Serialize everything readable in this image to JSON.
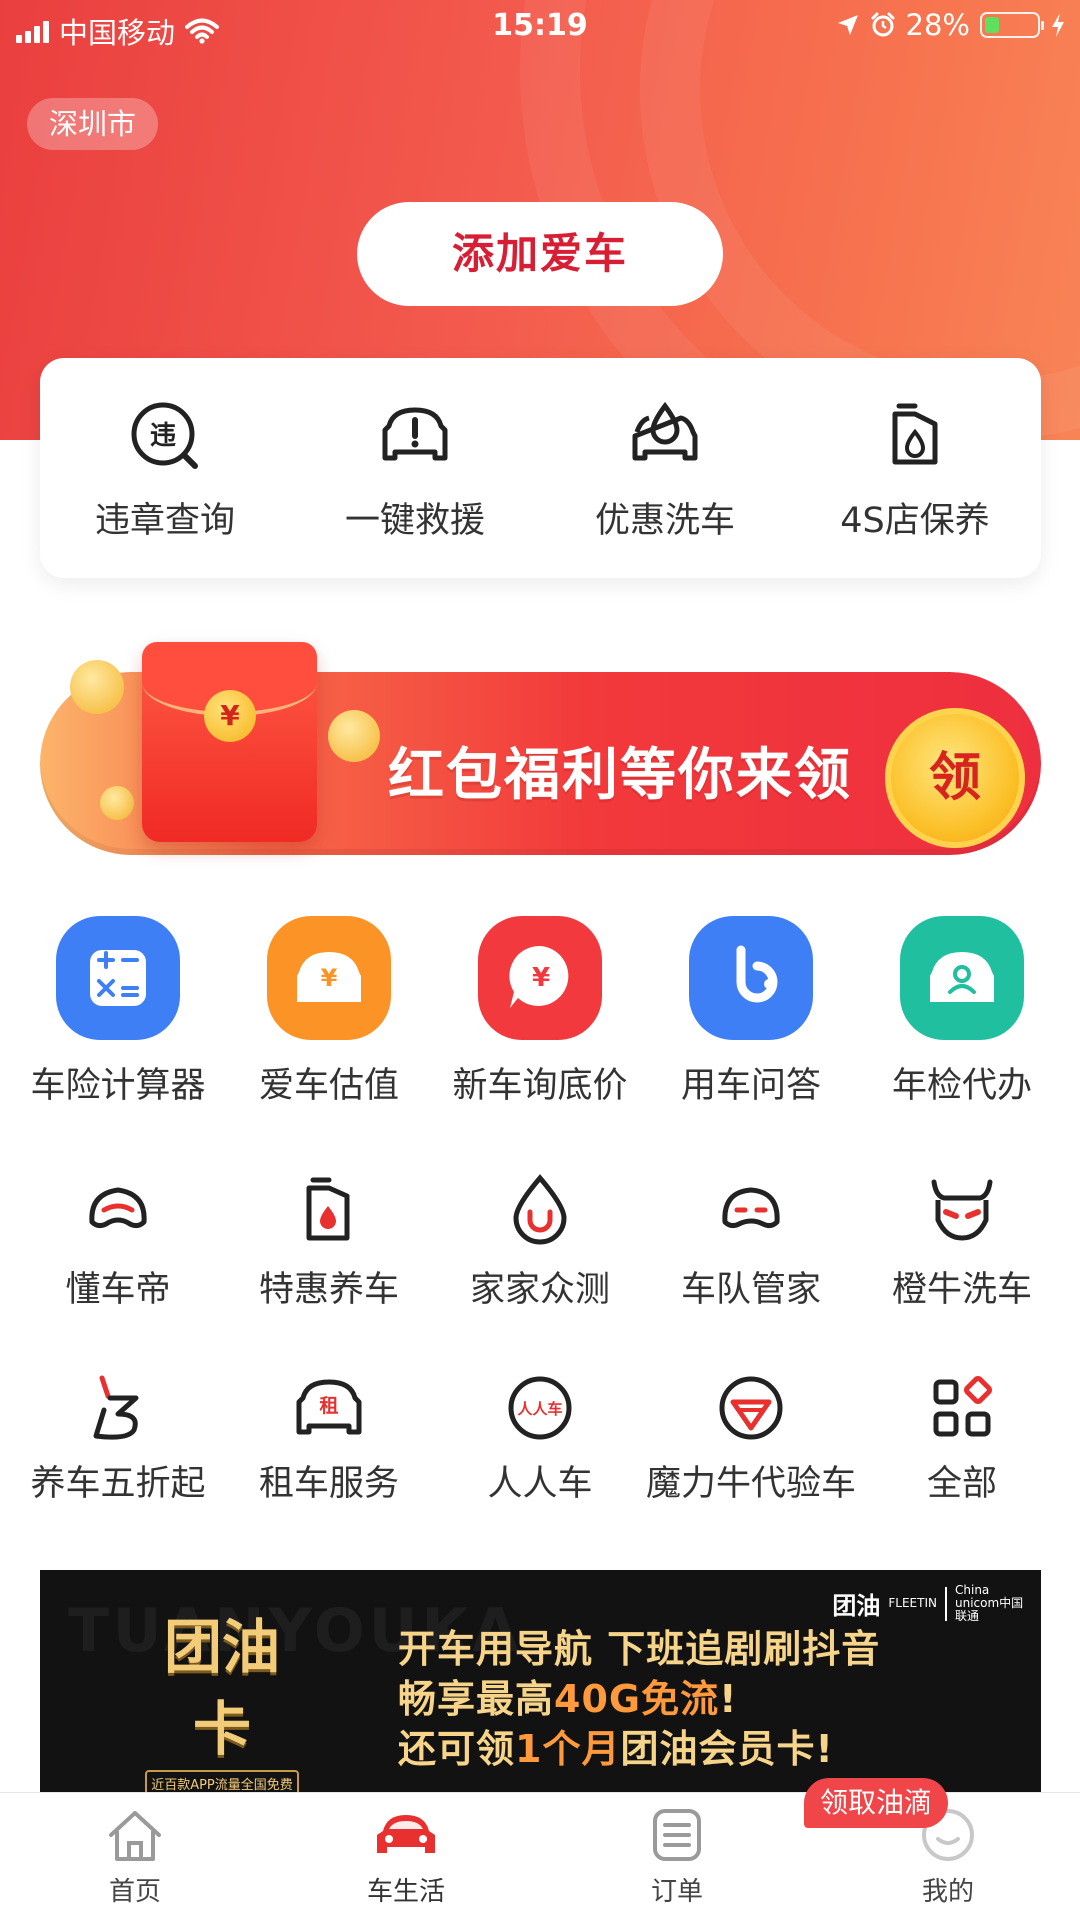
{
  "status_bar": {
    "carrier": "中国移动",
    "time": "15:19",
    "battery": "28%",
    "battery_level": 0.28
  },
  "header": {
    "city": "深圳市",
    "add_car_label": "添加爱车"
  },
  "quick_services": [
    {
      "label": "违章查询",
      "icon": "violation-search-icon",
      "glyph": "违"
    },
    {
      "label": "一键救援",
      "icon": "car-rescue-icon"
    },
    {
      "label": "优惠洗车",
      "icon": "car-wash-icon"
    },
    {
      "label": "4S店保养",
      "icon": "oil-can-icon"
    }
  ],
  "promo_banner": {
    "text": "红包福利等你来领",
    "claim_label": "领",
    "envelope_symbol": "¥"
  },
  "services_row1": [
    {
      "label": "车险计算器",
      "icon": "calculator-icon",
      "color": "#3f7ff5"
    },
    {
      "label": "爱车估值",
      "icon": "car-valuation-icon",
      "color": "#fb9326"
    },
    {
      "label": "新车询底价",
      "icon": "price-inquiry-icon",
      "color": "#f2393e"
    },
    {
      "label": "用车问答",
      "icon": "qa-icon",
      "color": "#3f7ff5"
    },
    {
      "label": "年检代办",
      "icon": "annual-inspection-icon",
      "color": "#1fbf9f"
    }
  ],
  "services_row2": [
    {
      "label": "懂车帝",
      "icon": "dongchedi-icon"
    },
    {
      "label": "特惠养车",
      "icon": "oil-drop-can-icon"
    },
    {
      "label": "家家众测",
      "icon": "magnet-drop-icon"
    },
    {
      "label": "车队管家",
      "icon": "fleet-face-icon"
    },
    {
      "label": "橙牛洗车",
      "icon": "bull-icon"
    }
  ],
  "services_row3": [
    {
      "label": "养车五折起",
      "icon": "discount-logo-icon"
    },
    {
      "label": "租车服务",
      "icon": "rental-car-icon",
      "glyph": "租"
    },
    {
      "label": "人人车",
      "icon": "renrenche-icon",
      "glyph": "人人车"
    },
    {
      "label": "魔力牛代验车",
      "icon": "moliniu-icon"
    },
    {
      "label": "全部",
      "icon": "all-grid-icon"
    }
  ],
  "ad_banner": {
    "watermark": "TUANYOUKA",
    "logo_text": "团油卡",
    "logo_subtext": "近百款APP流量全国免费",
    "line1": "开车用导航 下班追剧刷抖音",
    "line2_a": "畅享最高",
    "line2_hi": "40G免流",
    "line2_b": "!",
    "line3_a": "还可领",
    "line3_hi": "1个月",
    "line3_b": "团油会员卡!",
    "brand_a": "团油",
    "brand_a_sub": "FLEETIN",
    "brand_b": "China unicom中国联通"
  },
  "oil_badge": "领取油滴",
  "tab_bar": [
    {
      "label": "首页",
      "icon": "home-icon",
      "active": false
    },
    {
      "label": "车生活",
      "icon": "car-icon",
      "active": true
    },
    {
      "label": "订单",
      "icon": "order-list-icon",
      "active": false
    },
    {
      "label": "我的",
      "icon": "profile-icon",
      "active": false
    }
  ],
  "colors": {
    "brand_red": "#d81e35",
    "header_gradient_start": "#ea3f3f",
    "header_gradient_end": "#f88456",
    "tab_active": "#e8302f"
  }
}
